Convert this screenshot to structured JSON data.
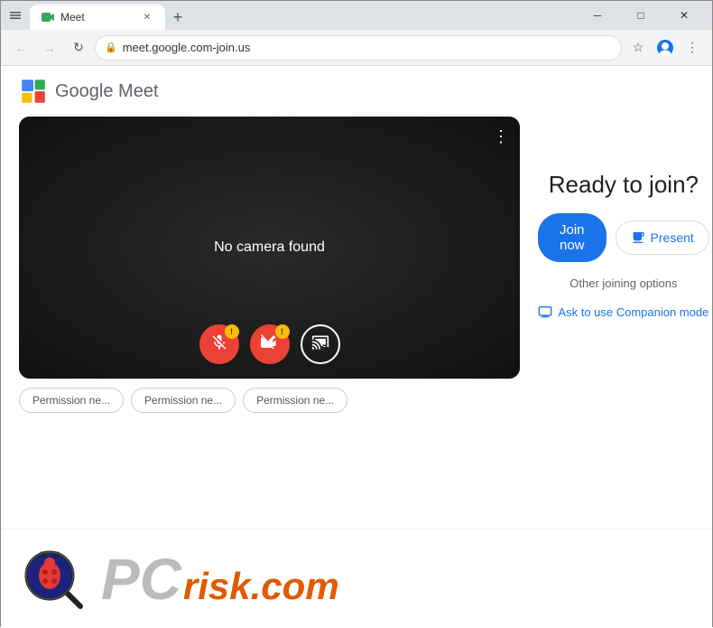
{
  "browser": {
    "title": "Meet",
    "url": "meet.google.com-join.us",
    "tab_label": "Meet",
    "new_tab_label": "+",
    "nav": {
      "back": "←",
      "forward": "→",
      "refresh": "↻"
    },
    "window_controls": {
      "minimize": "─",
      "maximize": "□",
      "close": "✕"
    },
    "address_icons": {
      "star": "☆",
      "account": "👤",
      "menu": "⋮"
    }
  },
  "meet": {
    "logo_text": "Google Meet",
    "video": {
      "no_camera_text": "No camera found",
      "more_options": "⋮"
    },
    "controls": {
      "mute_label": "mic-off",
      "camera_label": "cam-off",
      "cast_label": "cast"
    },
    "permissions": [
      "Permission ne...",
      "Permission ne...",
      "Permission ne..."
    ],
    "right_panel": {
      "title": "Ready to join?",
      "join_now": "Join now",
      "present": "Present",
      "other_options": "Other joining options",
      "companion_text": "Ask to use Companion mode"
    }
  },
  "pcrisk": {
    "pc_text": "PC",
    "risk_text": "risk.com"
  }
}
